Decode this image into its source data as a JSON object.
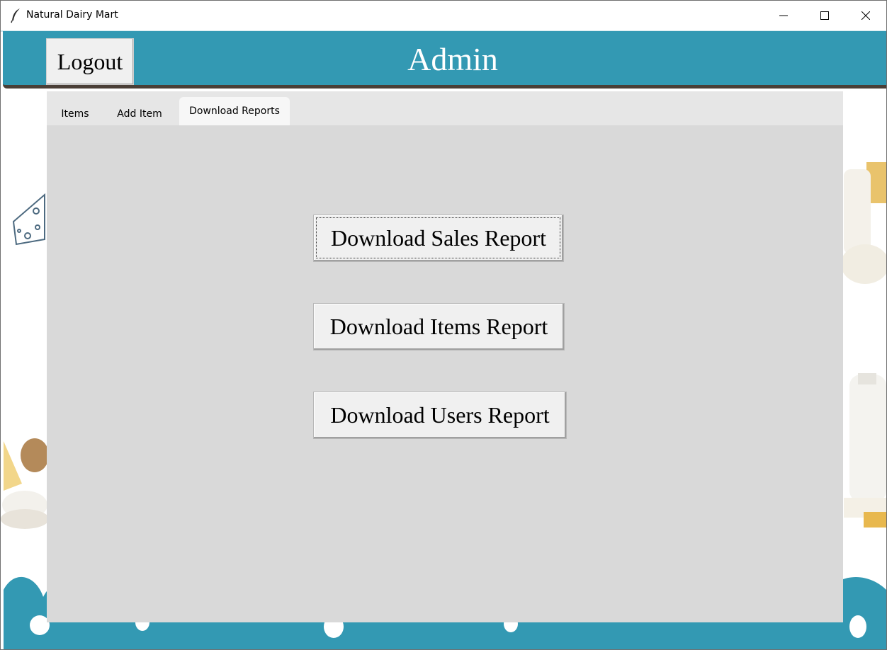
{
  "window": {
    "title": "Natural Dairy Mart",
    "icon": "feather-icon",
    "controls": [
      "minimize-icon",
      "maximize-icon",
      "close-icon"
    ]
  },
  "header": {
    "logout_label": "Logout",
    "title": "Admin",
    "color": "#3399b3"
  },
  "tabs": [
    {
      "label": "Items",
      "active": false
    },
    {
      "label": "Add Item",
      "active": false
    },
    {
      "label": "Download Reports",
      "active": true
    }
  ],
  "reports": {
    "sales_label": "Download Sales Report",
    "items_label": "Download Items Report",
    "users_label": "Download Users Report"
  },
  "colors": {
    "accent": "#3399b3",
    "content_bg": "#d9d9d9",
    "button_bg": "#f0f0f0"
  }
}
